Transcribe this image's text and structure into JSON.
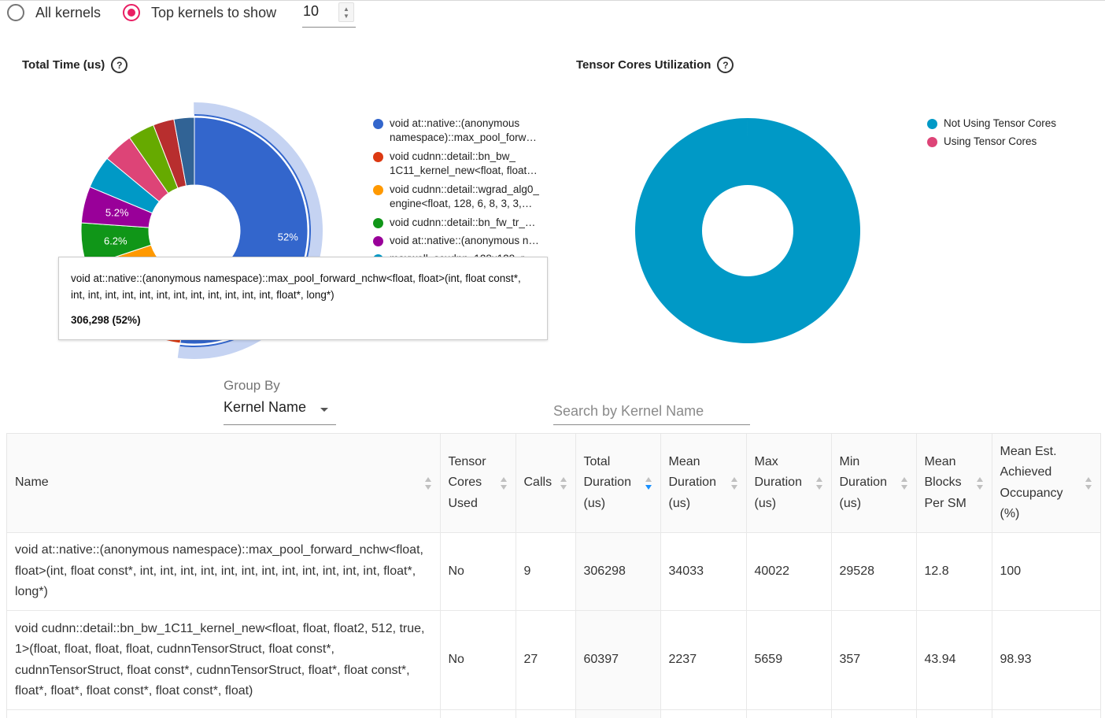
{
  "controls": {
    "all_kernels_label": "All kernels",
    "top_kernels_label": "Top kernels to show",
    "top_kernels_value": "10"
  },
  "total_time_chart": {
    "title": "Total Time (us)",
    "legend": [
      {
        "label": "void at::native::(anonymous\nnamespace)::max_pool_forw…",
        "color": "#3366cc"
      },
      {
        "label": "void cudnn::detail::bn_bw_\n1C11_kernel_new<float, float…",
        "color": "#dc3912"
      },
      {
        "label": "void cudnn::detail::wgrad_alg0_\nengine<float, 128, 6, 8, 3, 3,…",
        "color": "#ff9900"
      },
      {
        "label": "void cudnn::detail::bn_fw_tr_…",
        "color": "#109618"
      },
      {
        "label": "void at::native::(anonymous n…",
        "color": "#990099"
      },
      {
        "label": "maxwell_scudnn_128x128_r…",
        "color": "#0099c6"
      }
    ],
    "visible_slice_labels": [
      "52%",
      "6.2%",
      "5.2%"
    ],
    "tooltip": {
      "name": "void at::native::(anonymous namespace)::max_pool_forward_nchw<float, float>(int, float const*, int, int, int, int, int, int, int, int, int, int, int, int, float*, long*)",
      "value": "306,298 (52%)"
    }
  },
  "tensor_chart": {
    "title": "Tensor Cores Utilization",
    "legend": [
      {
        "label": "Not Using Tensor Cores",
        "color": "#0099c6"
      },
      {
        "label": "Using Tensor Cores",
        "color": "#dd4477"
      }
    ]
  },
  "chart_data": [
    {
      "type": "pie",
      "title": "Total Time (us)",
      "slices": [
        {
          "label": "void at::native::(anonymous namespace)::max_pool_forward_nchw<float, float>(int, float const*, int, int, int, int, int, int, int, int, int, int, int, int, float*, long*)",
          "value": 52,
          "color": "#3366cc"
        },
        {
          "label": "void cudnn::detail::bn_bw_1C11_kernel_new<float, float…",
          "value": 10.3,
          "color": "#dc3912"
        },
        {
          "label": "void cudnn::detail::wgrad_alg0_engine<float, 128, 6, 8, 3, 3,…",
          "value": 7.6,
          "color": "#ff9900"
        },
        {
          "label": "void cudnn::detail::bn_fw_tr_…",
          "value": 6.2,
          "color": "#109618"
        },
        {
          "label": "void at::native::(anonymous n…",
          "value": 5.2,
          "color": "#990099"
        },
        {
          "label": "maxwell_scudnn_128x128_r…",
          "value": 4.7,
          "color": "#0099c6"
        },
        {
          "label": "",
          "value": 4.3,
          "color": "#dd4477"
        },
        {
          "label": "",
          "value": 3.8,
          "color": "#66aa00"
        },
        {
          "label": "",
          "value": 3.0,
          "color": "#b82e2e"
        },
        {
          "label": "",
          "value": 2.9,
          "color": "#316395"
        }
      ]
    },
    {
      "type": "pie",
      "title": "Tensor Cores Utilization",
      "slices": [
        {
          "label": "Not Using Tensor Cores",
          "value": 100,
          "color": "#0099c6"
        },
        {
          "label": "Using Tensor Cores",
          "value": 0,
          "color": "#dd4477"
        }
      ]
    }
  ],
  "group_by": {
    "label": "Group By",
    "value": "Kernel Name"
  },
  "search": {
    "placeholder": "Search by Kernel Name"
  },
  "table": {
    "headers": [
      "Name",
      "Tensor Cores Used",
      "Calls",
      "Total Duration (us)",
      "Mean Duration (us)",
      "Max Duration (us)",
      "Min Duration (us)",
      "Mean Blocks Per SM",
      "Mean Est. Achieved Occupancy (%)"
    ],
    "rows": [
      [
        "void at::native::(anonymous namespace)::max_pool_forward_nchw<float, float>(int, float const*, int, int, int, int, int, int, int, int, int, int, int, int, float*, long*)",
        "No",
        "9",
        "306298",
        "34033",
        "40022",
        "29528",
        "12.8",
        "100"
      ],
      [
        "void cudnn::detail::bn_bw_1C11_kernel_new<float, float, float2, 512, true, 1>(float, float, float, float, cudnnTensorStruct, float const*, cudnnTensorStruct, float const*, cudnnTensorStruct, float*, float const*, float*, float*, float const*, float const*, float)",
        "No",
        "27",
        "60397",
        "2237",
        "5659",
        "357",
        "43.94",
        "98.93"
      ]
    ]
  }
}
